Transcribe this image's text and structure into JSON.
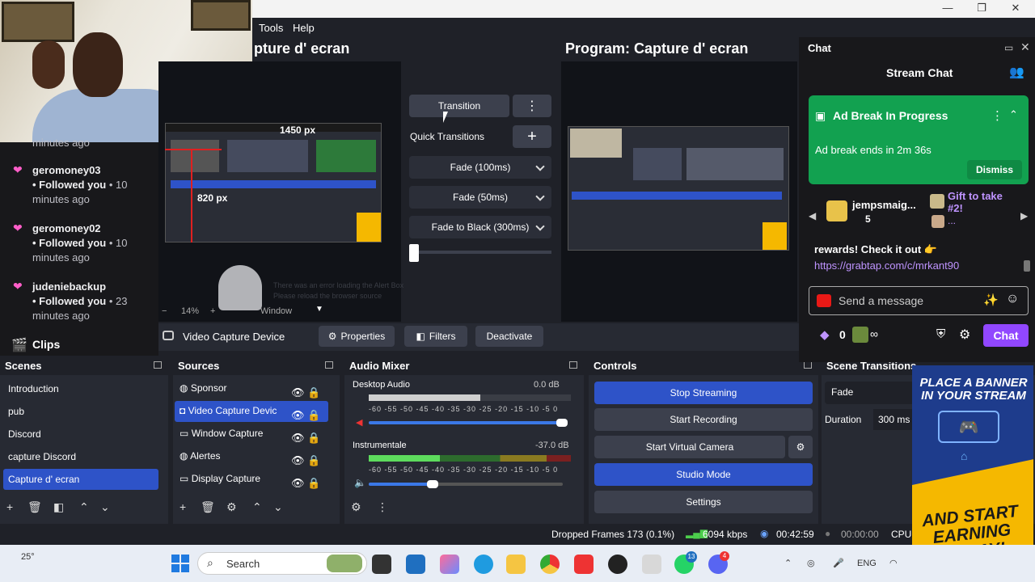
{
  "window": {
    "minimize": "—",
    "maximize": "❐",
    "close": "✕"
  },
  "menu": {
    "tools": "Tools",
    "help": "Help"
  },
  "follows": [
    {
      "line1": "minutes ago"
    },
    {
      "user": "geromoney03",
      "action": "• Followed you",
      "time": "• 10",
      "ago": "minutes ago"
    },
    {
      "user": "geromoney02",
      "action": "• Followed you",
      "time": "• 10",
      "ago": "minutes ago"
    },
    {
      "user": "judeniebackup",
      "action": "• Followed you",
      "time": "• 23",
      "ago": "minutes ago"
    }
  ],
  "clips_label": "Clips",
  "preview": {
    "title": "pture d' ecran",
    "dim1": "1450 px",
    "dim2": "820 px",
    "zoom": "14%",
    "window_label": "Window",
    "error_line1": "There was an error loading the Alert Box",
    "error_line2": "Please reload the browser source"
  },
  "program": {
    "title": "Program: Capture d' ecran"
  },
  "transition": {
    "button": "Transition",
    "quick_label": "Quick Transitions",
    "options": [
      "Fade (100ms)",
      "Fade (50ms)",
      "Fade to Black (300ms)"
    ]
  },
  "source_toolbar": {
    "source_name": "Video Capture Device",
    "properties": "Properties",
    "filters": "Filters",
    "deactivate": "Deactivate"
  },
  "scenes": {
    "title": "Scenes",
    "items": [
      "Introduction",
      "pub",
      "Discord",
      "capture Discord",
      "Capture d' ecran"
    ],
    "active_index": 4
  },
  "sources": {
    "title": "Sources",
    "items": [
      "Sponsor",
      "Video Capture Devic",
      "Window Capture",
      "Alertes",
      "Display Capture"
    ],
    "active_index": 1
  },
  "audio": {
    "title": "Audio Mixer",
    "tracks": [
      {
        "name": "Desktop Audio",
        "db": "0.0 dB",
        "level": 0.55,
        "volume": 1.0
      },
      {
        "name": "Instrumentale",
        "db": "-37.0 dB",
        "level": 0.35,
        "volume": 0.32
      }
    ],
    "scale": "-60 -55 -50 -45 -40 -35 -30 -25 -20 -15 -10 -5 0"
  },
  "controls": {
    "title": "Controls",
    "stop_streaming": "Stop Streaming",
    "start_recording": "Start Recording",
    "start_virtual_camera": "Start Virtual Camera",
    "studio_mode": "Studio Mode",
    "settings": "Settings"
  },
  "scene_transitions": {
    "title": "Scene Transitions",
    "value": "Fade",
    "duration_label": "Duration",
    "duration_value": "300 ms"
  },
  "status": {
    "dropped": "Dropped Frames 173 (0.1%)",
    "bitrate": "6094 kbps",
    "live_time": "00:42:59",
    "rec_time": "00:00:00",
    "cpu": "CPU:"
  },
  "chat": {
    "dock_title": "Chat",
    "header": "Stream Chat",
    "ad_title": "Ad Break In Progress",
    "ad_text": "Ad break ends in 2m 36s",
    "dismiss": "Dismiss",
    "gift_user": "jempsmaig...",
    "gift_count": "5",
    "gift_take": "Gift to take",
    "gift_take2": "#2!",
    "gift_dots": "...",
    "message": "rewards! Check it out 👉",
    "link": "https://grabtap.com/c/mrkant90",
    "placeholder": "Send a message",
    "points": "0",
    "infinity": "∞",
    "chat_button": "Chat"
  },
  "banner": {
    "top": "PLACE A BANNER IN YOUR STREAM",
    "bottom": "AND START EARNING TODAY!"
  },
  "taskbar": {
    "temp": "25°",
    "search": "Search",
    "lang": "ENG",
    "badge1": "13",
    "badge2": "4"
  },
  "colors": {
    "accent": "#2e53c8",
    "twitch": "#9147ff",
    "ad_green": "#12a150"
  }
}
